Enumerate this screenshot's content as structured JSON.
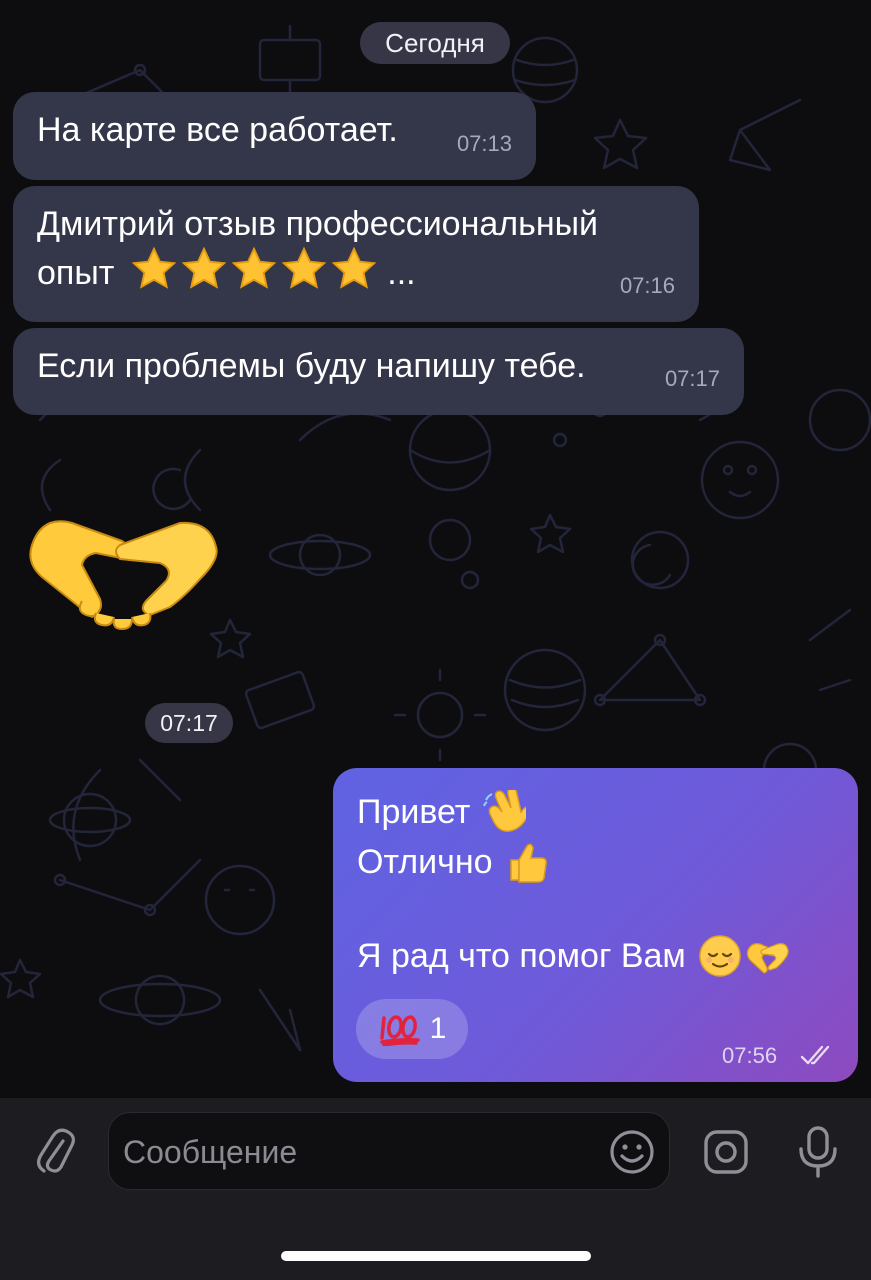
{
  "chat": {
    "date_label": "Сегодня",
    "messages_in": [
      {
        "text": "На карте все работает.",
        "time": "07:13"
      },
      {
        "text_line1": "Дмитрий отзыв профессиональный",
        "text_line2": "опыт",
        "suffix": "...",
        "stars": 5,
        "time": "07:16"
      },
      {
        "text": "Если проблемы буду напишу тебе.",
        "time": "07:17"
      }
    ],
    "sticker": {
      "icon": "handshake-icon",
      "time": "07:17"
    },
    "message_out": {
      "line1": "Привет",
      "line2": "Отлично",
      "line3": "Я рад что помог Вам",
      "reaction": {
        "icon": "hundred-points-icon",
        "count": "1"
      },
      "time": "07:56",
      "status_icon": "double-check-icon"
    }
  },
  "composer": {
    "placeholder": "Сообщение",
    "icons": [
      "paperclip-icon",
      "emoji-icon",
      "camera-icon",
      "microphone-icon"
    ]
  },
  "colors": {
    "background": "#0d0d10",
    "incoming_bubble": "#34364a",
    "outgoing_gradient_start": "#5f63e3",
    "outgoing_gradient_end": "#8e4abf",
    "input_bar": "#1d1d21"
  }
}
